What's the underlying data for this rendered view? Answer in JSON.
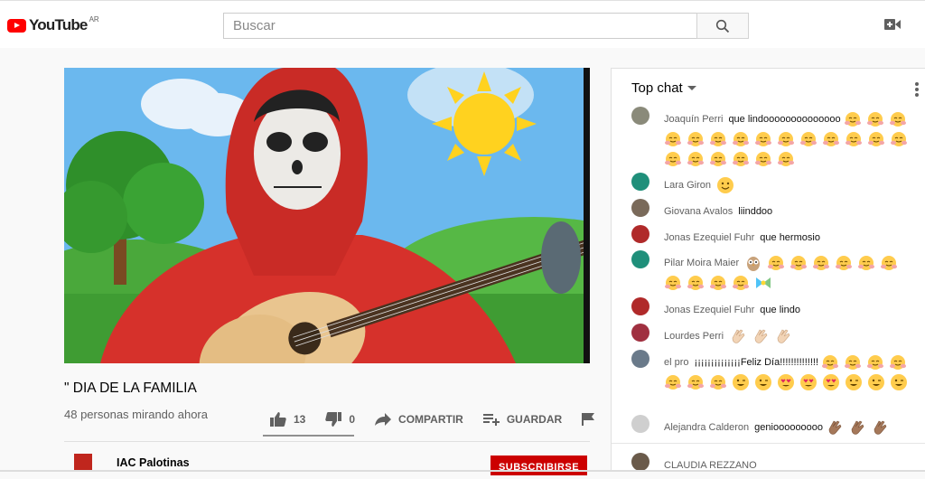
{
  "header": {
    "logo_text": "YouTube",
    "region": "AR",
    "search_placeholder": "Buscar"
  },
  "video": {
    "title": "\" DIA DE LA FAMILIA",
    "viewers": "48 personas mirando ahora",
    "likes": "13",
    "dislikes": "0",
    "share_label": "COMPARTIR",
    "save_label": "GUARDAR",
    "like_ratio": 1.0
  },
  "channel": {
    "name": "IAC Palotinas",
    "subscribe_label": "SUBSCRIBIRSE"
  },
  "chat": {
    "title": "Top chat",
    "messages": [
      {
        "author": "Joaquín Perri",
        "text": "que lindoooooooooooooo",
        "avatar_color": "#8a8a7a",
        "emojis": [
          "hug",
          "hug",
          "hug",
          "hug",
          "hug",
          "hug",
          "hug",
          "hug",
          "hug",
          "hug",
          "hug",
          "hug",
          "hug",
          "hug",
          "hug",
          "hug",
          "hug",
          "hug",
          "hug",
          "hug"
        ]
      },
      {
        "author": "Lara Giron",
        "text": "",
        "avatar_color": "#1f8f7a",
        "emojis": [
          "smile"
        ]
      },
      {
        "author": "Giovana Avalos",
        "text": "liinddoo",
        "avatar_color": "#7a6a5a",
        "emojis": []
      },
      {
        "author": "Jonas Ezequiel Fuhr",
        "text": "que hermosio",
        "avatar_color": "#b02a2a",
        "emojis": []
      },
      {
        "author": "Pilar Moira Maier",
        "text": "",
        "avatar_color": "#1f8f7a",
        "emojis": [
          "owl",
          "hug",
          "hug",
          "hug",
          "hug",
          "hug",
          "hug",
          "hug",
          "hug",
          "hug",
          "hug",
          "bow"
        ]
      },
      {
        "author": "Jonas Ezequiel Fuhr",
        "text": "que lindo",
        "avatar_color": "#b02a2a",
        "emojis": []
      },
      {
        "author": "Lourdes Perri",
        "text": "",
        "avatar_color": "#a03040",
        "emojis": [
          "clap",
          "clap",
          "clap"
        ]
      },
      {
        "author": "el pro",
        "text": "¡¡¡¡¡¡¡¡¡¡¡¡¡¡Feliz Día!!!!!!!!!!!!!!",
        "avatar_color": "#6a7a8a",
        "emojis": [
          "hug",
          "hug",
          "hug",
          "hug",
          "hug",
          "hug",
          "hug",
          "grin",
          "grin",
          "heart_eyes",
          "heart_eyes",
          "heart_eyes",
          "grin",
          "grin",
          "grin"
        ]
      },
      {
        "author": "Alejandra Calderon",
        "text": "geniooooooooo",
        "avatar_color": "#cfcfcf",
        "emojis": [
          "clap_dark",
          "clap_dark",
          "clap_dark"
        ]
      },
      {
        "author": "CLAUDIA REZZANO",
        "text": "",
        "avatar_color": "#6a5a4a",
        "emojis": []
      }
    ]
  },
  "colors": {
    "brand_red": "#ff0000",
    "subscribe_red": "#cc0000",
    "sky": "#5aa9e6",
    "hoodie": "#d6312b",
    "grass": "#4caf3c"
  }
}
